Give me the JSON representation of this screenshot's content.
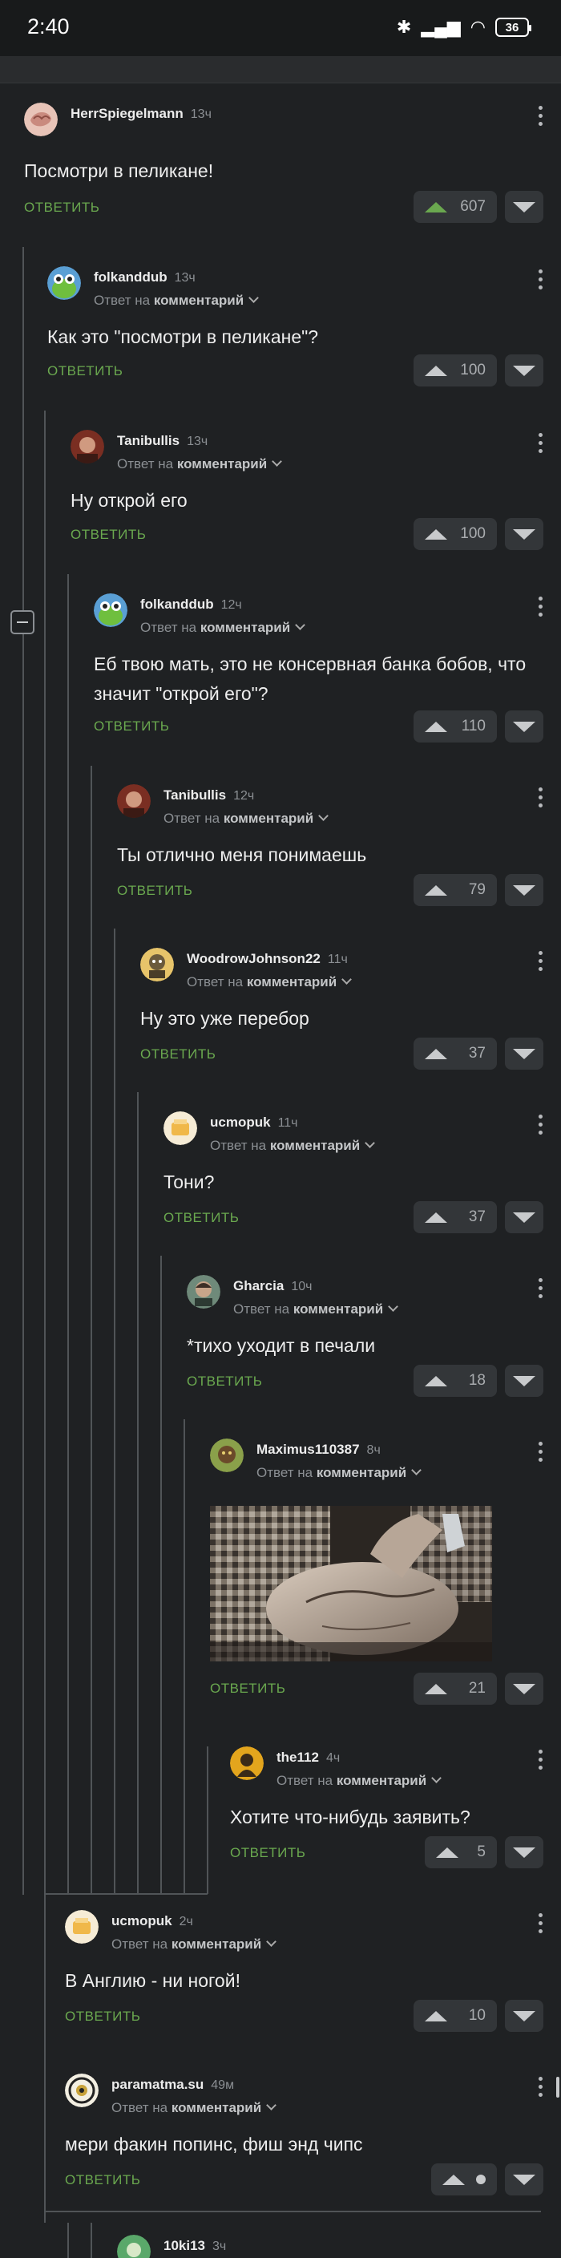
{
  "status_bar": {
    "time": "2:40",
    "battery": "36"
  },
  "labels": {
    "reply": "ОТВЕТИТЬ",
    "reply_to_prefix": "Ответ на",
    "reply_to_target": "комментарий"
  },
  "comments": [
    {
      "author": "HerrSpiegelmann",
      "time": "13ч",
      "text": "Посмотри в пеликане!",
      "votes": "607",
      "voted_up": true
    },
    {
      "author": "folkanddub",
      "time": "13ч",
      "text": "Как это \"посмотри в пеликане\"?",
      "votes": "100"
    },
    {
      "author": "Tanibullis",
      "time": "13ч",
      "text": "Ну открой его",
      "votes": "100"
    },
    {
      "author": "folkanddub",
      "time": "12ч",
      "text": "Еб твою мать, это не консервная банка бобов, что значит \"открой его\"?",
      "votes": "110"
    },
    {
      "author": "Tanibullis",
      "time": "12ч",
      "text": "Ты отлично меня понимаешь",
      "votes": "79"
    },
    {
      "author": "WoodrowJohnson22",
      "time": "11ч",
      "text": "Ну это уже перебор",
      "votes": "37"
    },
    {
      "author": "ucmopuk",
      "time": "11ч",
      "text": "Тони?",
      "votes": "37"
    },
    {
      "author": "Gharcia",
      "time": "10ч",
      "text": "*тихо уходит в печали",
      "votes": "18"
    },
    {
      "author": "Maximus110387",
      "time": "8ч",
      "text": "",
      "votes": "21",
      "has_image": true
    },
    {
      "author": "the112",
      "time": "4ч",
      "text": "Хотите что-нибудь заявить?",
      "votes": "5"
    },
    {
      "author": "ucmopuk",
      "time": "2ч",
      "text": "В Англию - ни ногой!",
      "votes": "10"
    },
    {
      "author": "paramatma.su",
      "time": "49м",
      "text": "мери факин попинс, фиш энд чипс",
      "votes": "",
      "pending": true
    },
    {
      "author": "10ki13",
      "time": "3ч",
      "text": "",
      "votes": ""
    }
  ]
}
